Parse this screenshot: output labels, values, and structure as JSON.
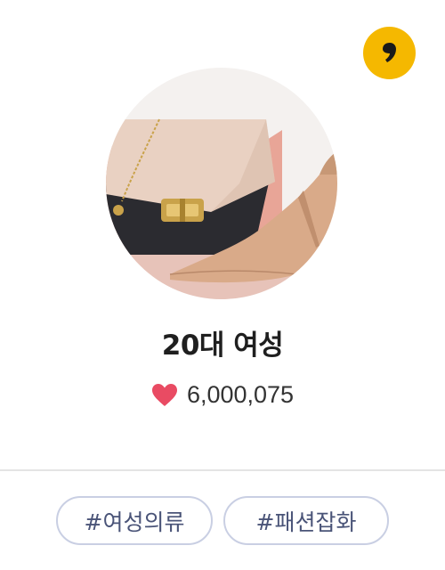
{
  "card": {
    "title": "20대 여성",
    "likes": "6,000,075",
    "tags": [
      {
        "label": "#여성의류"
      },
      {
        "label": "#패션잡화"
      }
    ]
  },
  "icons": {
    "badge": "kakao-comma-icon",
    "likes": "heart-icon"
  },
  "colors": {
    "badge": "#f5b800",
    "heart": "#e94b63",
    "tag_border": "#c9cfe3",
    "tag_text": "#4a5478",
    "title": "#1f1f1f"
  }
}
